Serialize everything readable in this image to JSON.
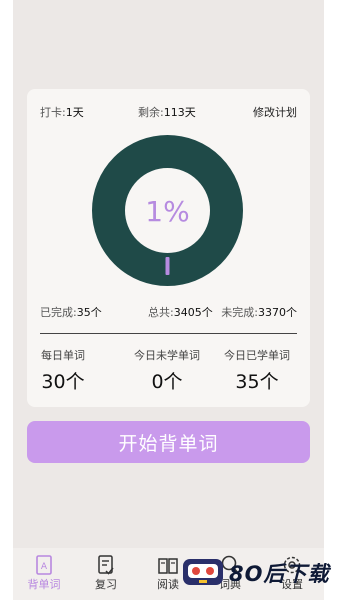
{
  "stats_top": {
    "checkin_label": "打卡:",
    "checkin_value": "1天",
    "remaining_label": "剩余:",
    "remaining_value": "113天",
    "edit_plan": "修改计划"
  },
  "progress": {
    "percent_text": "1%",
    "fraction": 0.01,
    "ring_color": "#1f4a48",
    "accent_color": "#b68be0"
  },
  "stats_bottom": {
    "completed_label": "已完成:",
    "completed_value": "35个",
    "total_label": "总共:",
    "total_value": "3405个",
    "remaining_label": "未完成:",
    "remaining_value": "3370个"
  },
  "daily": [
    {
      "label": "每日单词",
      "value": "30个"
    },
    {
      "label": "今日未学单词",
      "value": "0个"
    },
    {
      "label": "今日已学单词",
      "value": "35个"
    }
  ],
  "start_button": "开始背单词",
  "tabs": [
    {
      "label": "背单词",
      "icon": "flashcard-icon",
      "active": true
    },
    {
      "label": "复习",
      "icon": "review-checklist-icon",
      "active": false
    },
    {
      "label": "阅读",
      "icon": "book-icon",
      "active": false
    },
    {
      "label": "词典",
      "icon": "search-icon",
      "active": false
    },
    {
      "label": "设置",
      "icon": "gear-icon",
      "active": false
    }
  ],
  "watermark": {
    "text": "8O后下载"
  },
  "colors": {
    "button": "#c99aec",
    "background": "#ece8e6",
    "card": "#f8f6f4"
  }
}
